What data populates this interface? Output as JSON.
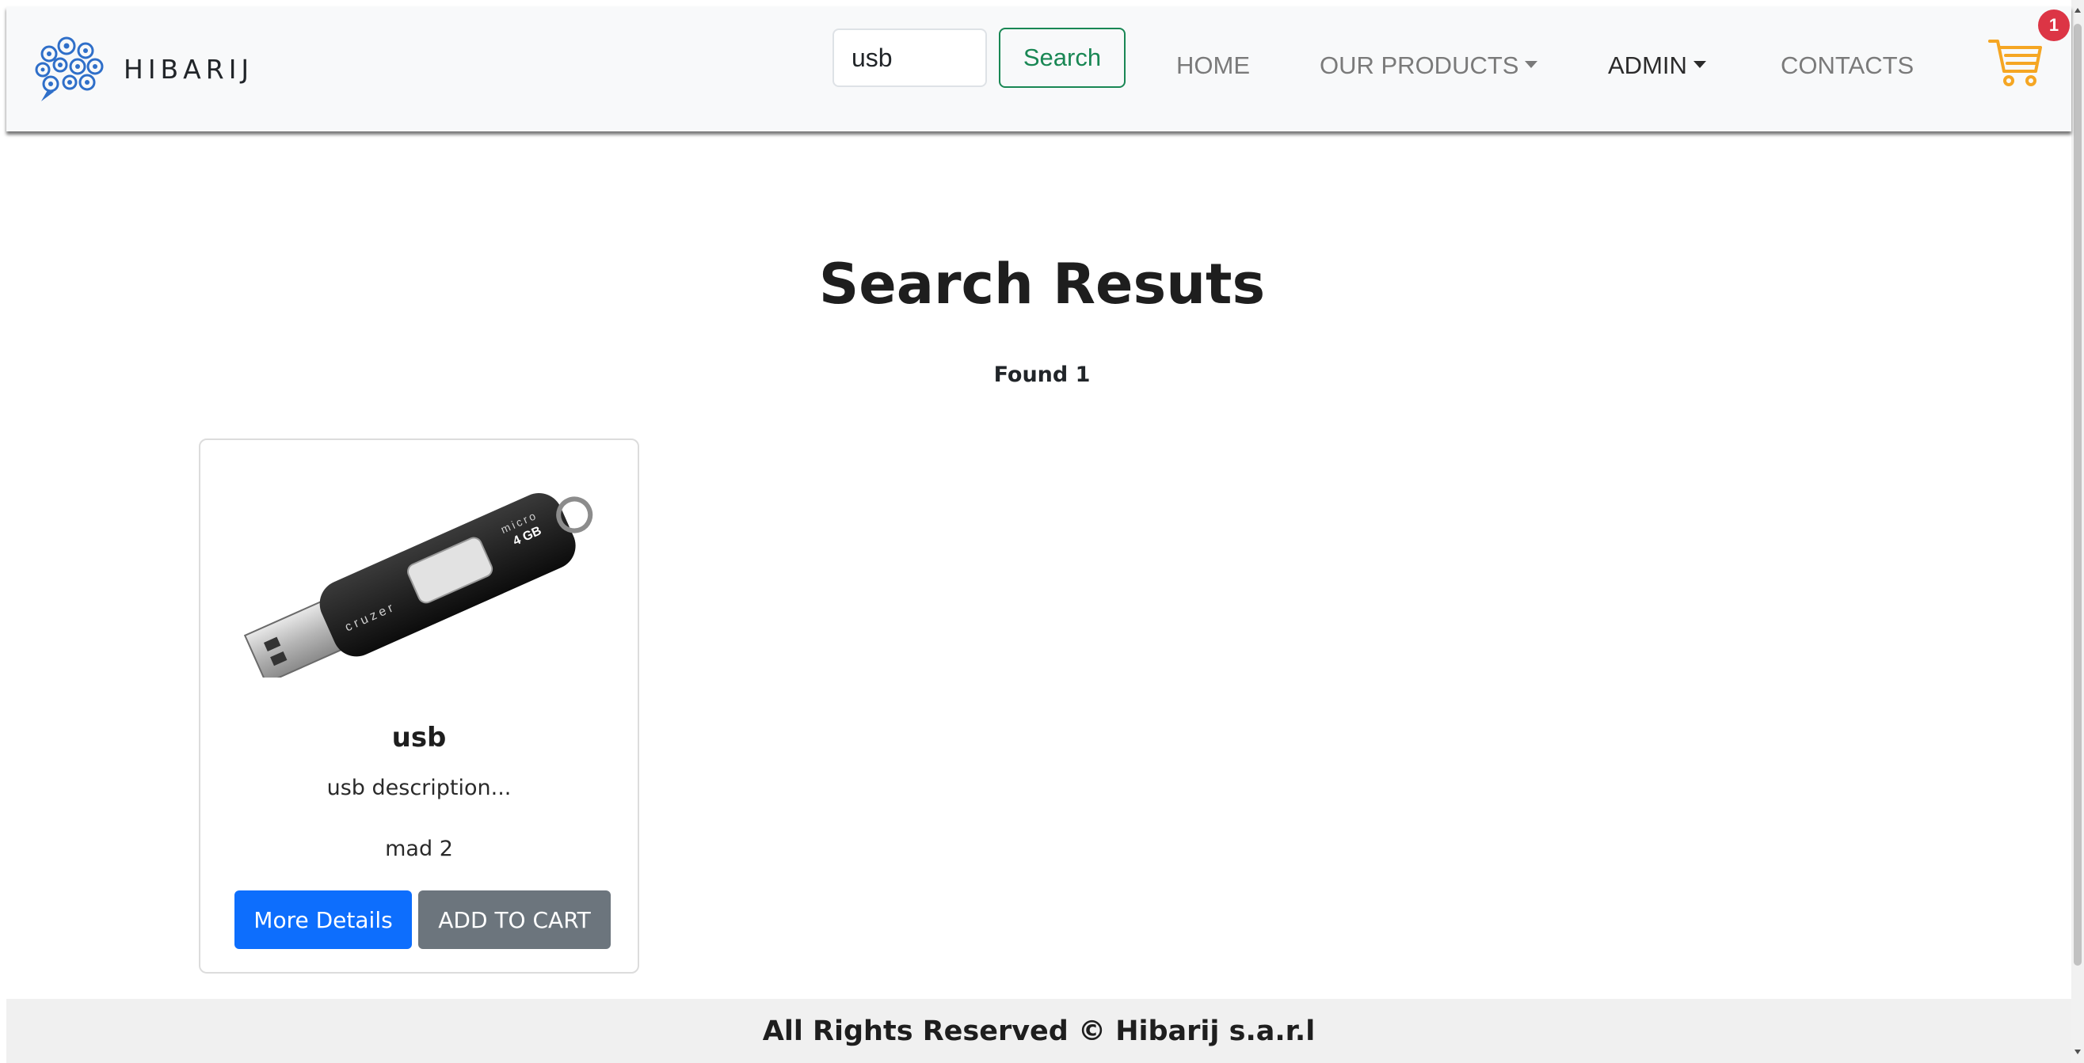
{
  "brand": {
    "name": "HIBARIJ"
  },
  "search": {
    "value": "usb",
    "button_label": "Search"
  },
  "nav": {
    "home": "HOME",
    "products": "OUR PRODUCTS",
    "admin": "ADMIN",
    "contacts": "CONTACTS"
  },
  "cart": {
    "count": "1"
  },
  "main": {
    "title": "Search Resuts",
    "found": "Found 1"
  },
  "results": [
    {
      "title": "usb",
      "description": "usb description...",
      "price": "mad 2",
      "details_label": "More Details",
      "cart_label": "ADD TO CART"
    }
  ],
  "footer": {
    "text": "All Rights Reserved © Hibarij s.a.r.l"
  },
  "colors": {
    "primary": "#0d6efd",
    "success": "#198754",
    "secondary": "#6c757d",
    "danger": "#dc3545",
    "cart_icon": "#f5a623",
    "logo": "#2f6fc9"
  }
}
